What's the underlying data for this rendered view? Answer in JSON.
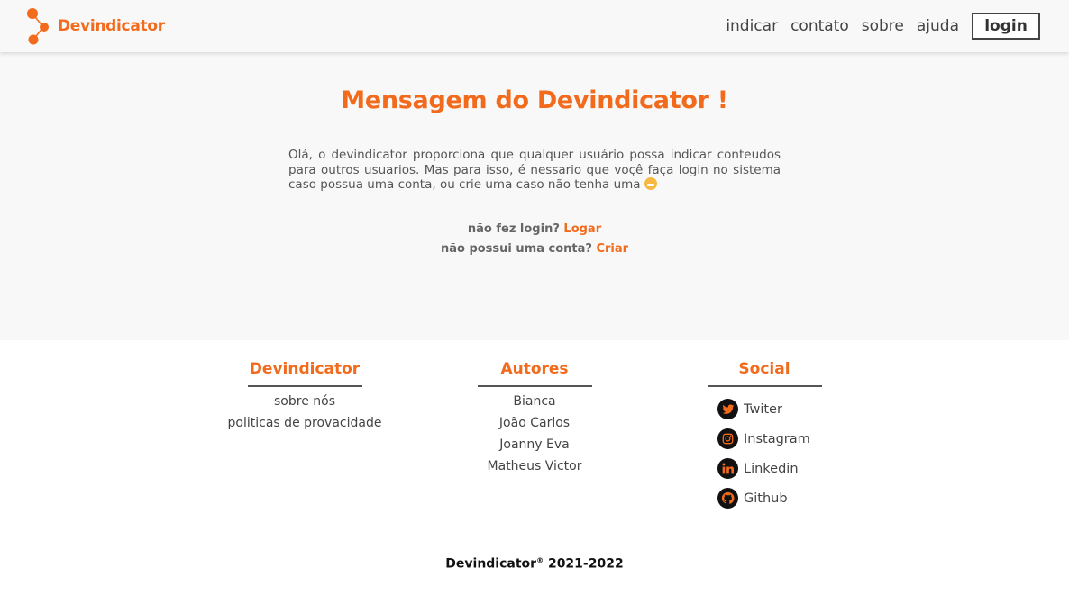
{
  "header": {
    "brand": "Devindicator",
    "nav": [
      {
        "label": "indicar"
      },
      {
        "label": "contato"
      },
      {
        "label": "sobre"
      },
      {
        "label": "ajuda"
      }
    ],
    "login_label": "login"
  },
  "main": {
    "title": "Mensagem do Devindicator !",
    "message": "Olá, o devindicator proporciona que qualquer usuário possa indicar conteudos para outros usuarios. Mas para isso, é nessario que voçê faça login no sistema caso possua uma conta, ou crie uma caso não tenha uma",
    "login_prompt": "não fez login?",
    "login_link": "Logar",
    "signup_prompt": "não possui uma conta?",
    "signup_link": "Criar"
  },
  "footer": {
    "columns": {
      "brand": {
        "title": "Devindicator",
        "items": [
          "sobre nós",
          "politicas de provacidade"
        ]
      },
      "authors": {
        "title": "Autores",
        "items": [
          "Bianca",
          "João Carlos",
          "Joanny Eva",
          "Matheus Victor"
        ]
      },
      "social": {
        "title": "Social",
        "items": [
          {
            "label": "Twiter",
            "icon": "twitter-icon"
          },
          {
            "label": "Instagram",
            "icon": "instagram-icon"
          },
          {
            "label": "Linkedin",
            "icon": "linkedin-icon"
          },
          {
            "label": "Github",
            "icon": "github-icon"
          }
        ]
      }
    },
    "copyright_name": "Devindicator",
    "copyright_mark": "®",
    "copyright_years": "2021-2022"
  },
  "colors": {
    "accent": "#f26b1d",
    "header_bg": "#f8f8f8",
    "text": "#444444"
  }
}
